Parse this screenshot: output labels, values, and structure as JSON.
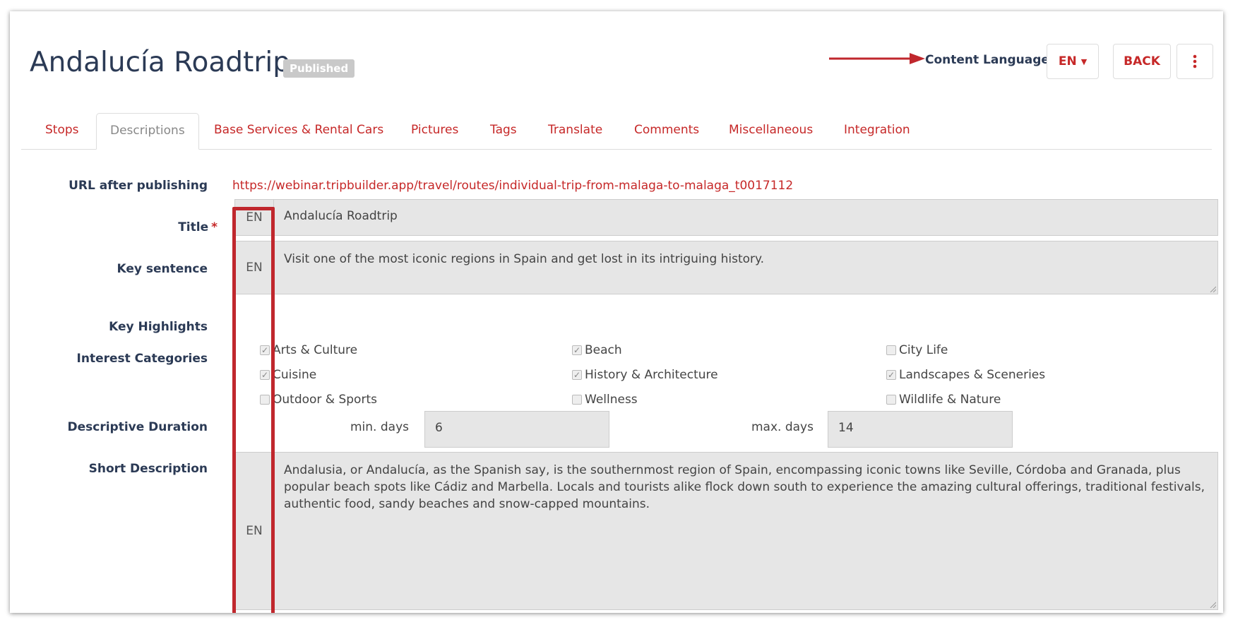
{
  "header": {
    "title": "Andalucía Roadtrip",
    "status": "Published",
    "content_language_label": "Content Language",
    "language_value": "EN",
    "back_label": "BACK",
    "more_icon": "more-vertical-icon"
  },
  "tabs": [
    {
      "label": "Stops"
    },
    {
      "label": "Descriptions"
    },
    {
      "label": "Base Services & Rental Cars"
    },
    {
      "label": "Pictures"
    },
    {
      "label": "Tags"
    },
    {
      "label": "Translate"
    },
    {
      "label": "Comments"
    },
    {
      "label": "Miscellaneous"
    },
    {
      "label": "Integration"
    }
  ],
  "active_tab": "Descriptions",
  "form": {
    "url_label": "URL after publishing",
    "url_value": "https://webinar.tripbuilder.app/travel/routes/individual-trip-from-malaga-to-malaga_t0017112",
    "title_label": "Title",
    "required_mark": "*",
    "title_lang": "EN",
    "title_value": "Andalucía Roadtrip",
    "key_sentence_label": "Key sentence",
    "key_sentence_lang": "EN",
    "key_sentence_value": "Visit one of the most iconic regions in Spain and get lost in its intriguing history.",
    "key_highlights_label": "Key Highlights",
    "interest_label": "Interest Categories",
    "categories": [
      {
        "label": "Arts & Culture",
        "checked": true
      },
      {
        "label": "Beach",
        "checked": true
      },
      {
        "label": "City Life",
        "checked": false
      },
      {
        "label": "Cuisine",
        "checked": true
      },
      {
        "label": "History & Architecture",
        "checked": true
      },
      {
        "label": "Landscapes & Sceneries",
        "checked": true
      },
      {
        "label": "Outdoor & Sports",
        "checked": false
      },
      {
        "label": "Wellness",
        "checked": false
      },
      {
        "label": "Wildlife & Nature",
        "checked": false
      }
    ],
    "duration_label": "Descriptive Duration",
    "min_days_label": "min. days",
    "min_days_value": "6",
    "max_days_label": "max. days",
    "max_days_value": "14",
    "short_desc_label": "Short Description",
    "short_desc_lang": "EN",
    "short_desc_value": "Andalusia, or Andalucía, as the Spanish say, is the southernmost region of Spain, encompassing iconic towns like Seville, Córdoba and Granada, plus popular beach spots like Cádiz and Marbella. Locals and tourists alike flock down south to experience the amazing cultural offerings, traditional festivals, authentic food, sandy beaches and snow-capped mountains."
  },
  "colors": {
    "accent": "#c62828",
    "title": "#2b3a55",
    "annotation": "#c0272d",
    "field_bg": "#e6e6e6"
  }
}
